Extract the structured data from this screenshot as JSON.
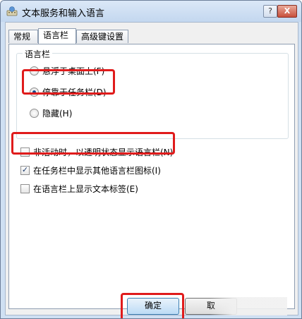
{
  "window": {
    "title": "文本服务和输入语言",
    "help_label": "?",
    "close_label": "X"
  },
  "tabs": [
    {
      "label": "常规",
      "active": false
    },
    {
      "label": "语言栏",
      "active": true
    },
    {
      "label": "高级键设置",
      "active": false
    }
  ],
  "language_bar_group": {
    "title": "语言栏",
    "options": [
      {
        "label": "悬浮于桌面上(F)",
        "selected": false
      },
      {
        "label": "停靠于任务栏(D)",
        "selected": true
      },
      {
        "label": "隐藏(H)",
        "selected": false
      }
    ]
  },
  "checkboxes": [
    {
      "label": "非活动时，以透明状态显示语言栏(N)",
      "checked": false
    },
    {
      "label": "在任务栏中显示其他语言栏图标(I)",
      "checked": true
    },
    {
      "label": "在语言栏上显示文本标签(E)",
      "checked": false
    }
  ],
  "buttons": {
    "ok": "确定",
    "cancel": "取"
  },
  "colors": {
    "highlight": "#e01b1b",
    "titlebar": "#cfe0f3"
  },
  "icons": {
    "app": "keyboard-globe-icon",
    "check_mark": "✓"
  }
}
